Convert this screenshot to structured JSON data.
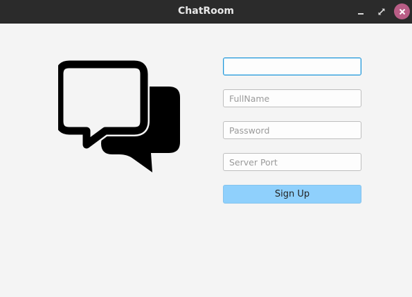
{
  "window": {
    "title": "ChatRoom",
    "minimize_icon": "minimize-icon",
    "maximize_icon": "maximize-icon",
    "close_icon": "close-icon",
    "close_color": "#b95d86"
  },
  "form": {
    "username": {
      "value": "",
      "placeholder": ""
    },
    "fullname": {
      "value": "",
      "placeholder": "FullName"
    },
    "password": {
      "value": "",
      "placeholder": "Password"
    },
    "server_port": {
      "value": "",
      "placeholder": "Server Port"
    },
    "signup_label": "Sign Up",
    "button_color": "#8fd0fc",
    "focus_color": "#1e96d8"
  },
  "logo": {
    "icon": "chat-bubbles-icon"
  }
}
